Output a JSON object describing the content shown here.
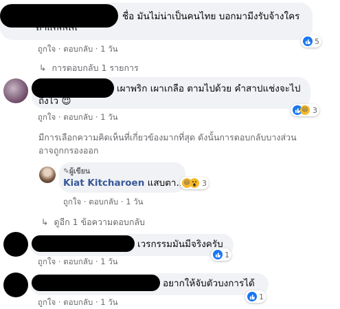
{
  "comments": [
    {
      "text": "ชื่อ มันไม่น่าเป็นคนไทย บอกมามีงรับจ้างใคร",
      "text_line2": "มาแบบนั้น",
      "actions": {
        "like": "ถูกใจ",
        "reply": "ตอบกลับ",
        "time": "1 วัน"
      },
      "reaction_count": "5",
      "replies_link": "การตอบกลับ 1 รายการ"
    },
    {
      "text": "เผาพริก เผาเกลือ ตามไปด้วย คำสาปแช่งจะไป",
      "text_line2": "ถึงไว",
      "emoji": "😈",
      "actions": {
        "like": "ถูกใจ",
        "reply": "ตอบกลับ",
        "time": "1 วัน"
      },
      "reaction_count": "3",
      "filter_notice_line1": "มีการเลือกความคิดเห็นที่เกี่ยวข้องมากที่สุด ดังนั้นการตอบกลับบางส่วน",
      "filter_notice_line2": "อาจถูกกรองออก",
      "reply": {
        "badge": "ผู้เขียน",
        "author": "Kiat Kitcharoen",
        "text": "แสบตา...",
        "actions": {
          "like": "ถูกใจ",
          "reply": "ตอบกลับ",
          "time": "1 วัน"
        },
        "reaction_count": "3"
      },
      "more_link": "ดูอีก 1 ข้อความตอบกลับ"
    },
    {
      "text": "เวรกรรมมันมีจริงครับ",
      "actions": {
        "like": "ถูกใจ",
        "reply": "ตอบกลับ",
        "time": "1 วัน"
      },
      "reaction_count": "1"
    },
    {
      "text": "อยากให้จับตัวบงการได้",
      "actions": {
        "like": "ถูกใจ",
        "reply": "ตอบกลับ",
        "time": "1 วัน"
      },
      "reaction_count": "1"
    }
  ],
  "separator": " · ",
  "colors": {
    "bubble": "#f0f2f5",
    "meta": "#65676b",
    "like": "#1877f2",
    "link": "#385898"
  }
}
